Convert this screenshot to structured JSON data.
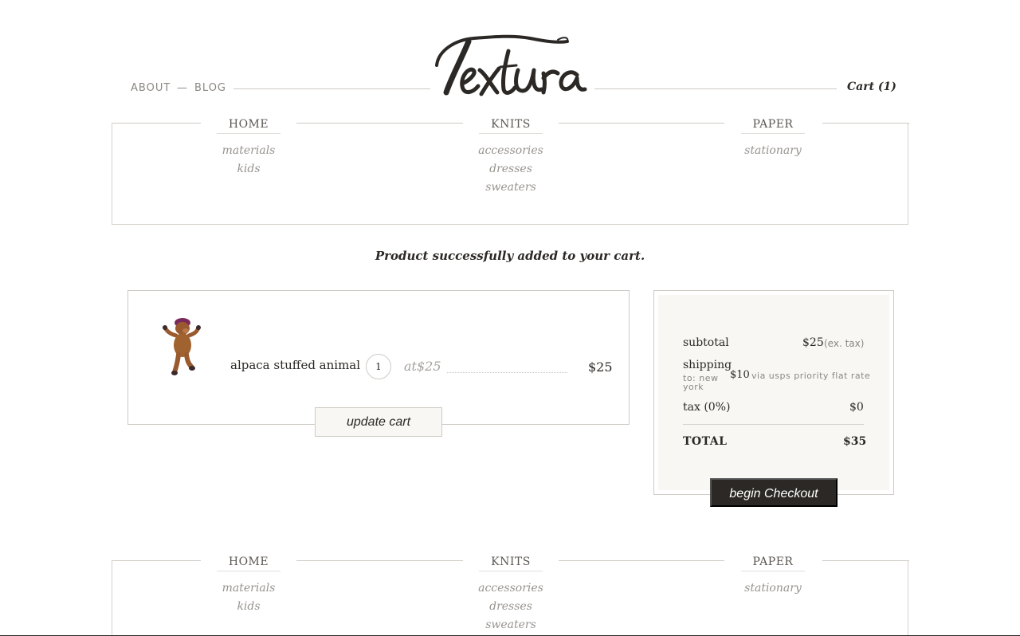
{
  "header": {
    "about_label": "ABOUT",
    "separator": "—",
    "blog_label": "BLOG",
    "brand_name": "Textura",
    "cart_label": "Cart (1)"
  },
  "menu": {
    "columns": [
      {
        "label": "HOME",
        "items": [
          "materials",
          "kids"
        ]
      },
      {
        "label": "KNITS",
        "items": [
          "accessories",
          "dresses",
          "sweaters"
        ]
      },
      {
        "label": "PAPER",
        "items": [
          "stationary"
        ]
      }
    ]
  },
  "notice": "Product successfully added to your cart.",
  "cart": {
    "item": {
      "name": "alpaca stuffed animal",
      "quantity": "1",
      "unit_price": "at$25",
      "line_total": "$25"
    },
    "update_label": "update cart"
  },
  "summary": {
    "subtotal_label": "subtotal",
    "subtotal_value": "$25",
    "subtotal_note": "(ex. tax)",
    "shipping_label": "shipping",
    "shipping_destination": "to: new york",
    "shipping_value": "$10",
    "shipping_method": "via usps priority flat rate",
    "tax_label": "tax (0%)",
    "tax_value": "$0",
    "total_label": "TOTAL",
    "total_value": "$35",
    "checkout_label": "begin Checkout"
  },
  "colors": {
    "ink": "#2b2825",
    "muted": "#97938e",
    "panel": "#f8f7f4",
    "rule": "#cfcbc6"
  }
}
